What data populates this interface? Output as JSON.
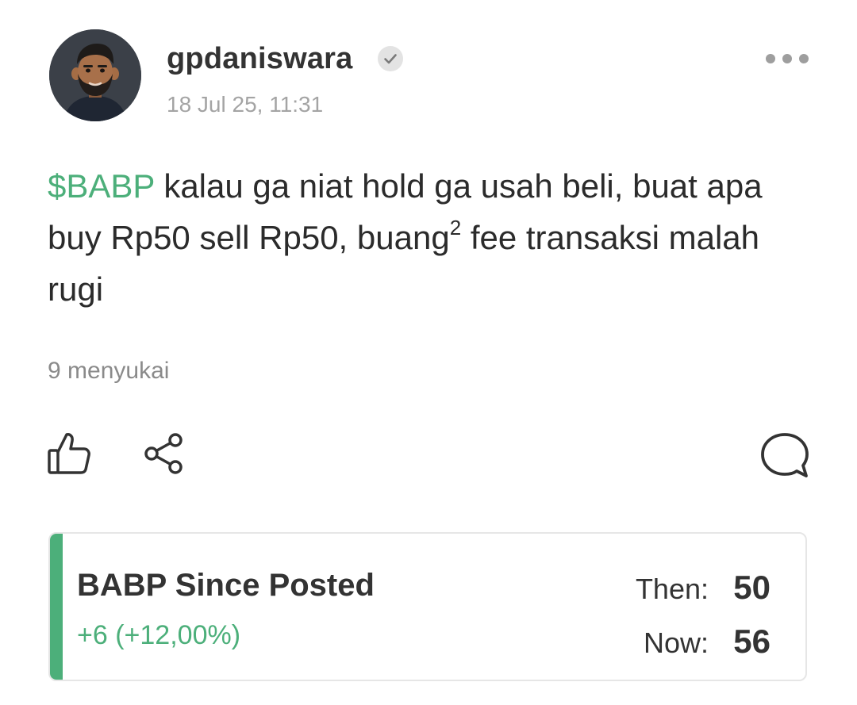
{
  "post": {
    "author": {
      "username": "gpdaniswara",
      "verified": true,
      "avatar_icon": "bearded-man-avatar"
    },
    "timestamp": "18 Jul 25, 11:31",
    "body": {
      "ticker": "$BABP",
      "text_before_superscript": " kalau ga niat hold ga usah beli, buat apa buy Rp50 sell Rp50, buang",
      "superscript": "2",
      "text_after_superscript": " fee transaksi malah rugi"
    },
    "likes_text": "9 menyukai",
    "actions": {
      "like_icon": "thumbs-up-icon",
      "share_icon": "share-icon",
      "comment_icon": "comment-bubble-icon",
      "more_icon": "more-dots-icon"
    }
  },
  "price_card": {
    "title": "BABP Since Posted",
    "change": "+6 (+12,00%)",
    "then_label": "Then:",
    "then_value": "50",
    "now_label": "Now:",
    "now_value": "56"
  },
  "colors": {
    "accent_green": "#4caf7a",
    "text_primary": "#333333",
    "text_muted": "#a4a4a4",
    "card_border": "#e6e6e6"
  }
}
